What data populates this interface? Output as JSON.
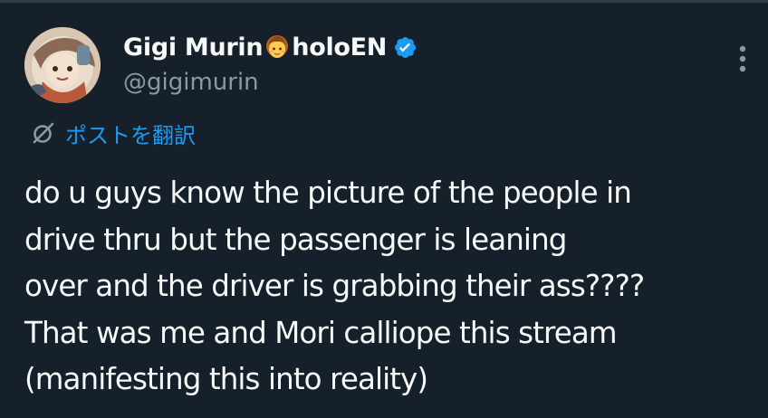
{
  "tweet": {
    "author": {
      "name_prefix": "Gigi Murin",
      "name_emoji": "girl-emoji",
      "name_suffix": "holoEN",
      "handle": "@gigimurin",
      "verified": true
    },
    "menu_icon": "more-vertical-icon",
    "translate": {
      "icon": "translate-globe-icon",
      "label": "ポストを翻訳"
    },
    "body_lines": [
      "do u guys know the picture of the people in",
      "drive thru but the passenger is leaning",
      "over and the driver is grabbing their ass????",
      "That was me and Mori calliope this stream",
      "(manifesting this into reality)"
    ]
  },
  "colors": {
    "background": "#15202b",
    "text": "#f7f9f9",
    "secondary_text": "#8b98a5",
    "accent": "#1d9bf0"
  }
}
